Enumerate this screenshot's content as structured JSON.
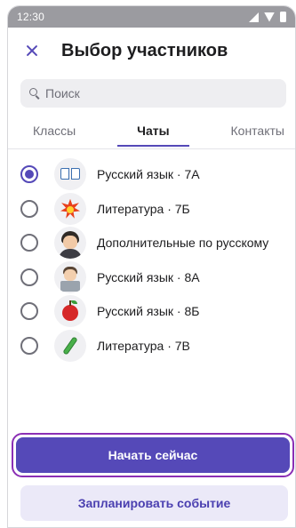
{
  "status_bar": {
    "time": "12:30"
  },
  "header": {
    "title": "Выбор участников"
  },
  "search": {
    "placeholder": "Поиск"
  },
  "tabs": [
    {
      "label": "Классы",
      "active": false
    },
    {
      "label": "Чаты",
      "active": true
    },
    {
      "label": "Контакты",
      "active": false
    }
  ],
  "chats": [
    {
      "label": "Русский язык · 7А",
      "icon": "book-icon",
      "selected": true
    },
    {
      "label": "Литература · 7Б",
      "icon": "burst-icon",
      "selected": false
    },
    {
      "label": "Дополнительные по русскому",
      "icon": "person-icon",
      "selected": false
    },
    {
      "label": "Русский язык · 8А",
      "icon": "coder-icon",
      "selected": false
    },
    {
      "label": "Русский язык · 8Б",
      "icon": "apple-icon",
      "selected": false
    },
    {
      "label": "Литература · 7В",
      "icon": "test-tube-icon",
      "selected": false
    }
  ],
  "actions": {
    "start_now": "Начать сейчас",
    "schedule": "Запланировать событие"
  },
  "colors": {
    "accent": "#5549b8",
    "highlight_border": "#8b2fb5",
    "secondary_bg": "#ebe9f8"
  }
}
